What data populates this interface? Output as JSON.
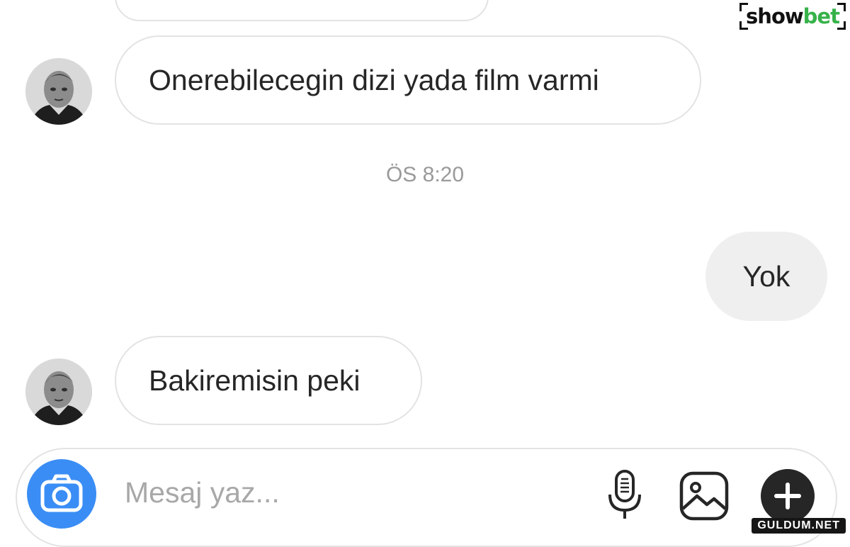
{
  "messages": [
    {
      "sender": "contact",
      "text": ""
    },
    {
      "sender": "contact",
      "text": "Onerebilecegin dizi yada film varmi"
    },
    {
      "sender": "me",
      "text": "Yok"
    },
    {
      "sender": "contact",
      "text": "Bakiremisin peki"
    }
  ],
  "timestamp": "ÖS 8:20",
  "composer": {
    "placeholder": "Mesaj yaz...",
    "icons": [
      "camera-icon",
      "microphone-icon",
      "gallery-icon",
      "plus-icon"
    ],
    "camera_color": "#3a8df5"
  },
  "logo": {
    "text_dark": "show",
    "text_green": "bet",
    "green": "#36b24a"
  },
  "watermark": "GULDUM.NET"
}
